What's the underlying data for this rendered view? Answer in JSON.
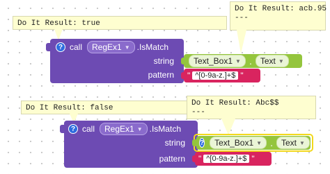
{
  "bubbles": {
    "b1": "Do It Result: true",
    "b2": "Do It Result: acb.95\n---",
    "b3": "Do It Result: false",
    "b4": "Do It Result: Abc$$\n---"
  },
  "block1": {
    "help": "?",
    "call": "call",
    "component": "RegEx1",
    "method": ".IsMatch",
    "string_label": "string",
    "pattern_label": "pattern",
    "textbox": "Text_Box1",
    "dot": ".",
    "property": "Text",
    "pattern_value": "^[0-9a-z.]+$",
    "quote_open": "\"",
    "quote_close": "\""
  },
  "block2": {
    "help": "?",
    "call": "call",
    "component": "RegEx1",
    "method": ".IsMatch",
    "string_label": "string",
    "pattern_label": "pattern",
    "textbox": "Text_Box1",
    "dot": ".",
    "property": "Text",
    "pattern_value": "^[0-9a-z.]+$",
    "quote_open": "\"",
    "quote_close": "\""
  },
  "colors": {
    "procedure": "#6d4bb3",
    "textbox": "#94c53d",
    "string": "#d9245f",
    "bubble": "#fefed0",
    "help": "#2d6cdf",
    "highlight": "#f2d81c"
  },
  "icons": {
    "help": "question-circle-icon",
    "dropdown": "chevron-down-icon"
  }
}
